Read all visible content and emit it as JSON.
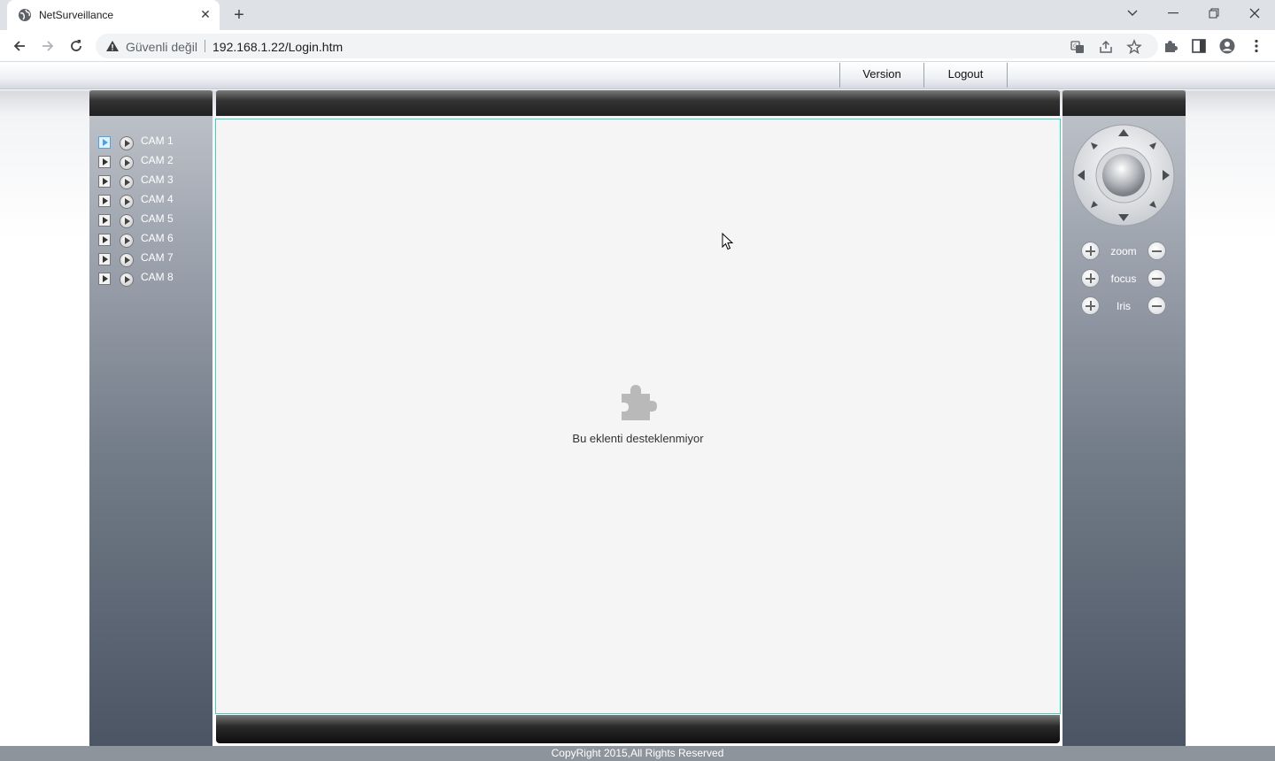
{
  "browser": {
    "tab_title": "NetSurveillance",
    "security_label": "Güvenli değil",
    "url": "192.168.1.22/Login.htm"
  },
  "topnav": {
    "version_label": "Version",
    "logout_label": "Logout"
  },
  "cameras": [
    {
      "label": "CAM 1",
      "active": true
    },
    {
      "label": "CAM 2",
      "active": false
    },
    {
      "label": "CAM 3",
      "active": false
    },
    {
      "label": "CAM 4",
      "active": false
    },
    {
      "label": "CAM 5",
      "active": false
    },
    {
      "label": "CAM 6",
      "active": false
    },
    {
      "label": "CAM 7",
      "active": false
    },
    {
      "label": "CAM 8",
      "active": false
    }
  ],
  "viewer": {
    "plugin_message": "Bu eklenti desteklenmiyor"
  },
  "ptz": {
    "zoom_label": "zoom",
    "focus_label": "focus",
    "iris_label": "Iris"
  },
  "footer": {
    "copyright": "CopyRight 2015,All Rights Reserved"
  },
  "colors": {
    "viewer_border": "#3fd0b8",
    "viewer_bg": "#f5f5f5",
    "panel_top": "#c2c6cd",
    "panel_bottom": "#4c5563"
  }
}
